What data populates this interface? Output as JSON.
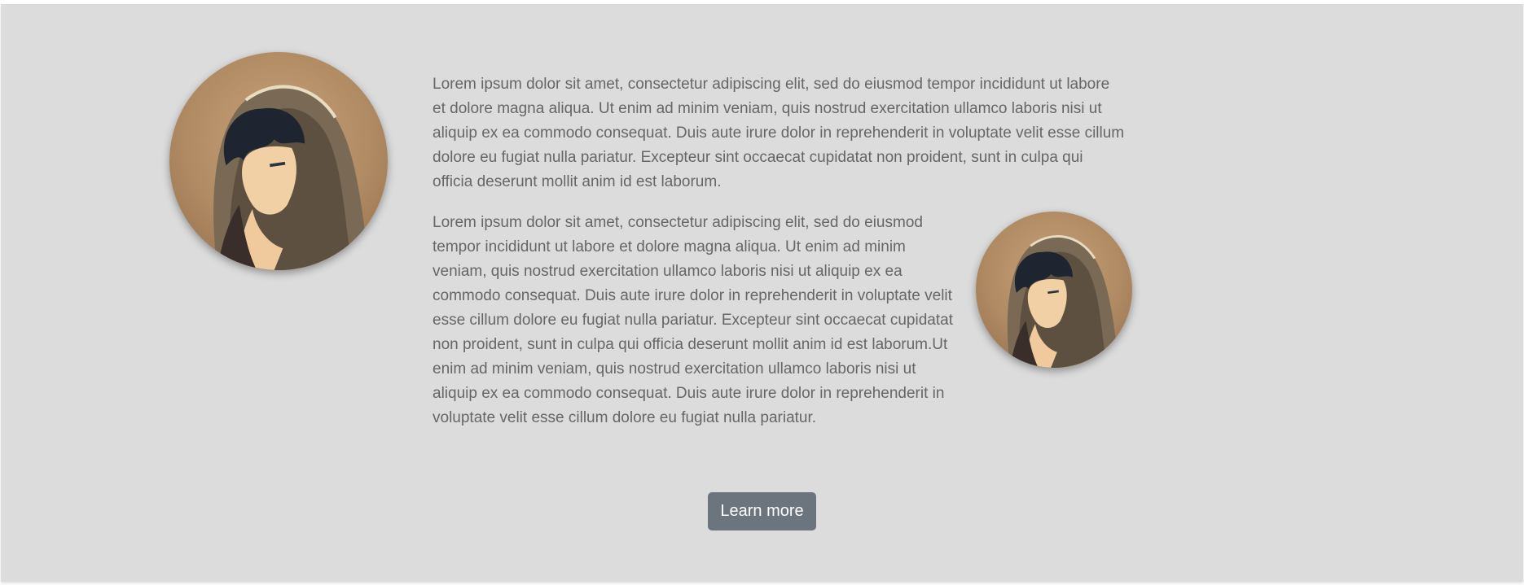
{
  "content": {
    "paragraph_1": "Lorem ipsum dolor sit amet, consectetur adipiscing elit, sed do eiusmod tempor incididunt ut labore et dolore magna aliqua. Ut enim ad minim veniam, quis nostrud exercitation ullamco laboris nisi ut aliquip ex ea commodo consequat. Duis aute irure dolor in reprehenderit in voluptate velit esse cillum dolore eu fugiat nulla pariatur. Excepteur sint occaecat cupidatat non proident, sunt in culpa qui officia deserunt mollit anim id est laborum.",
    "paragraph_2": "Lorem ipsum dolor sit amet, consectetur adipiscing elit, sed do eiusmod tempor incididunt ut labore et dolore magna aliqua. Ut enim ad minim veniam, quis nostrud exercitation ullamco laboris nisi ut aliquip ex ea commodo consequat. Duis aute irure dolor in reprehenderit in voluptate velit esse cillum dolore eu fugiat nulla pariatur. Excepteur sint occaecat cupidatat non proident, sunt in culpa qui officia deserunt mollit anim id est laborum.Ut enim ad minim veniam, quis nostrud exercitation ullamco laboris nisi ut aliquip ex ea commodo consequat. Duis aute irure dolor in reprehenderit in voluptate velit esse cillum dolore eu fugiat nulla pariatur.",
    "learn_more_label": "Learn more"
  },
  "images": {
    "avatar_large": "hooded-character-portrait",
    "avatar_small": "hooded-character-portrait"
  },
  "colors": {
    "background": "#dcdcdc",
    "text": "#666666",
    "button": "#6c757d",
    "button_text": "#ffffff"
  }
}
